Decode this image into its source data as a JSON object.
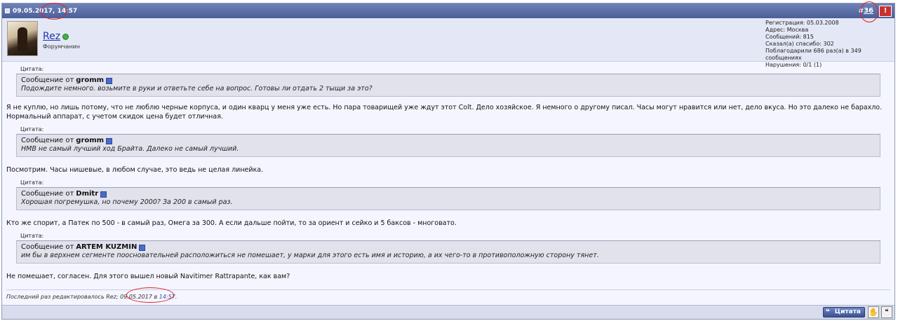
{
  "header": {
    "datetime": "09.05.2017, 14:57",
    "post_number_prefix": "#",
    "post_number": "36",
    "warn_label": "!"
  },
  "user": {
    "name": "Rez",
    "title": "Форумчанин",
    "info": [
      "Регистрация: 05.03.2008",
      "Адрес: Москва",
      "Сообщений: 815",
      "Сказал(а) спасибо: 302",
      "Поблагодарили 686 раз(а) в 349 сообщениях",
      "Нарушения: 0/1 (1)"
    ]
  },
  "quote_label": "Цитата:",
  "quote_from_prefix": "Сообщение от",
  "quotes": [
    {
      "author": "gromm",
      "text": "Подождите немного. возьмите в руки и ответьте себе на вопрос. Готовы ли отдать 2 тыщи за это?"
    },
    {
      "author": "gromm",
      "text": "НМВ не самый лучший ход Брайта. Далеко не самый лучший."
    },
    {
      "author": "Dmitr",
      "text": "Хорошая погремушка, но почему 2000? За 200 в самый раз."
    },
    {
      "author": "ARTEM KUZMIN",
      "text": "им бы в верхнем сегменте поосновательней расположиться не помешает, у марки для этого есть имя и историю, а их чего-то в противоположную сторону тянет."
    }
  ],
  "paragraphs": [
    "Я не куплю, но лишь потому, что не люблю черные корпуса, и один кварц у меня уже есть. Но пара товарищей уже ждут этот Colt. Дело хозяйское. Я немного о другому писал. Часы могут нравится или нет, дело вкуса. Но это далеко не барахло. Нормальный аппарат, с учетом скидок цена будет отличная.",
    "Посмотрим. Часы нишевые, в любом случае, это ведь не целая линейка.",
    "Кто же спорит, а Патек по 500 - в самый раз, Омега за 300. А если дальше пойти, то за ориент и сейко и 5 баксов - многовато.",
    "Не помешает, согласен. Для этого вышел новый Navitimer Rattrapante, как вам?"
  ],
  "edit_note": {
    "prefix": "Последний раз редактировалось Rez; 09.05.2017 в",
    "time": "14:57",
    "suffix": "."
  },
  "footer": {
    "quote_button": "Цитата",
    "thanks_icon": "hand-icon",
    "multiquote_icon": "multiquote-icon"
  },
  "accent_colors": {
    "header": "#4a5f9a",
    "username": "#2233aa",
    "annotation": "#e02020"
  }
}
